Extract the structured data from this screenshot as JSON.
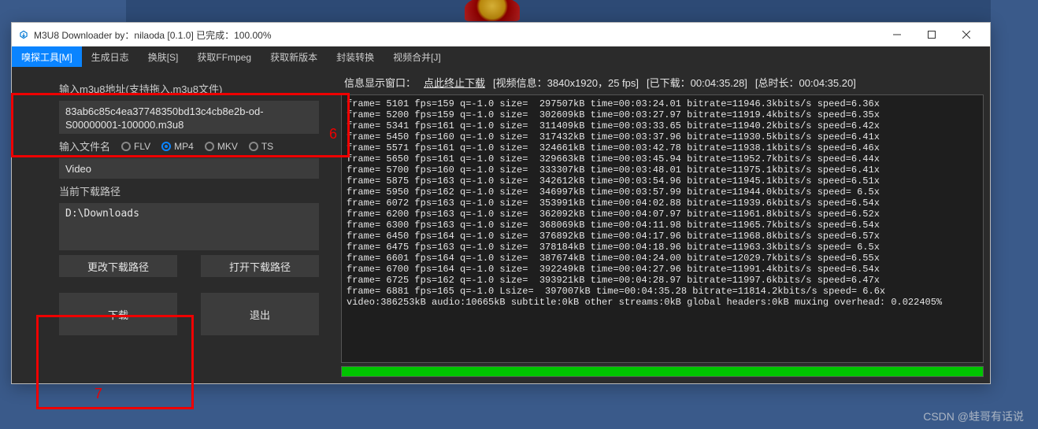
{
  "title": "M3U8 Downloader  by：nilaoda [0.1.0]     已完成：100.00%",
  "menu": [
    "嗅探工具[M]",
    "生成日志",
    "换肤[S]",
    "获取FFmpeg",
    "获取新版本",
    "封装转换",
    "视频合并[J]"
  ],
  "left": {
    "url_label": "输入m3u8地址(支持拖入.m3u8文件)",
    "url_value": "83ab6c85c4ea37748350bd13c4cb8e2b-od-S00000001-100000.m3u8",
    "filename_label": "输入文件名",
    "formats": [
      "FLV",
      "MP4",
      "MKV",
      "TS"
    ],
    "format_selected": 1,
    "video_value": "Video",
    "path_label": "当前下载路径",
    "path_value": "D:\\Downloads",
    "btn_change_path": "更改下载路径",
    "btn_open_path": "打开下载路径",
    "btn_download": "下载",
    "btn_exit": "退出"
  },
  "info": {
    "label": "信息显示窗口：",
    "stop_link": "点此终止下载",
    "video_info": "[视频信息：3840x1920，25 fps]",
    "downloaded": "[已下载：00:04:35.28]",
    "total": "[总时长：00:04:35.20]"
  },
  "console_lines": [
    "frame= 5101 fps=159 q=-1.0 size=  297507kB time=00:03:24.01 bitrate=11946.3kbits/s speed=6.36x",
    "frame= 5200 fps=159 q=-1.0 size=  302609kB time=00:03:27.97 bitrate=11919.4kbits/s speed=6.35x",
    "frame= 5341 fps=161 q=-1.0 size=  311409kB time=00:03:33.65 bitrate=11940.2kbits/s speed=6.42x",
    "frame= 5450 fps=160 q=-1.0 size=  317432kB time=00:03:37.96 bitrate=11930.5kbits/s speed=6.41x",
    "frame= 5571 fps=161 q=-1.0 size=  324661kB time=00:03:42.78 bitrate=11938.1kbits/s speed=6.46x",
    "frame= 5650 fps=161 q=-1.0 size=  329663kB time=00:03:45.94 bitrate=11952.7kbits/s speed=6.44x",
    "frame= 5700 fps=160 q=-1.0 size=  333307kB time=00:03:48.01 bitrate=11975.1kbits/s speed=6.41x",
    "frame= 5875 fps=163 q=-1.0 size=  342612kB time=00:03:54.96 bitrate=11945.1kbits/s speed=6.51x",
    "frame= 5950 fps=162 q=-1.0 size=  346997kB time=00:03:57.99 bitrate=11944.0kbits/s speed= 6.5x",
    "frame= 6072 fps=163 q=-1.0 size=  353991kB time=00:04:02.88 bitrate=11939.6kbits/s speed=6.54x",
    "frame= 6200 fps=163 q=-1.0 size=  362092kB time=00:04:07.97 bitrate=11961.8kbits/s speed=6.52x",
    "frame= 6300 fps=163 q=-1.0 size=  368069kB time=00:04:11.98 bitrate=11965.7kbits/s speed=6.54x",
    "frame= 6450 fps=164 q=-1.0 size=  376892kB time=00:04:17.96 bitrate=11968.8kbits/s speed=6.57x",
    "frame= 6475 fps=163 q=-1.0 size=  378184kB time=00:04:18.96 bitrate=11963.3kbits/s speed= 6.5x",
    "frame= 6601 fps=164 q=-1.0 size=  387674kB time=00:04:24.00 bitrate=12029.7kbits/s speed=6.55x",
    "frame= 6700 fps=164 q=-1.0 size=  392249kB time=00:04:27.96 bitrate=11991.4kbits/s speed=6.54x",
    "frame= 6725 fps=162 q=-1.0 size=  393921kB time=00:04:28.97 bitrate=11997.6kbits/s speed=6.47x",
    "frame= 6881 fps=165 q=-1.0 Lsize=  397007kB time=00:04:35.28 bitrate=11814.2kbits/s speed= 6.6x",
    "video:386253kB audio:10665kB subtitle:0kB other streams:0kB global headers:0kB muxing overhead: 0.022405%"
  ],
  "annotations": {
    "n6": "6",
    "n7": "7"
  },
  "watermark": "CSDN @蛙哥有话说"
}
